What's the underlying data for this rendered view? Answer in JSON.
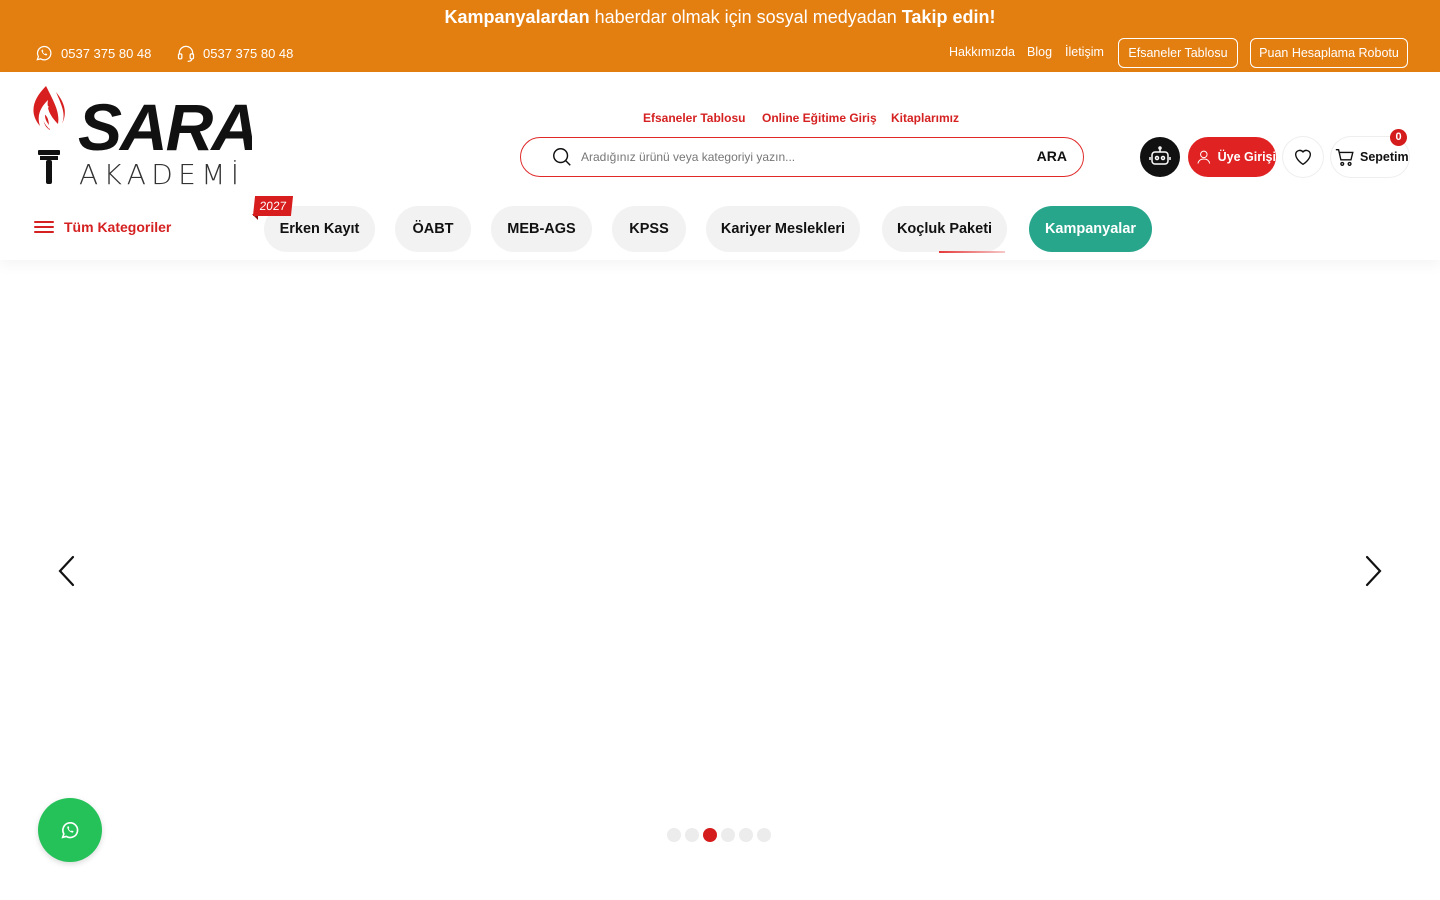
{
  "topbar": {
    "promo_strong1": "Kampanyalardan",
    "promo_mid": " haberdar olmak için sosyal medyadan ",
    "promo_strong2": "Takip edin!",
    "whatsapp_phone": "0537 375 80 48",
    "support_phone": "0537 375 80 48",
    "links": [
      "Hakkımızda",
      "Blog",
      "İletişim"
    ],
    "buttons": [
      "Efsaneler Tablosu",
      "Puan Hesaplama Robotu"
    ],
    "bg_color": "#e37e10"
  },
  "header": {
    "logo_main": "SARA",
    "logo_sub": "AKADEMİ",
    "quick_links": [
      "Efsaneler Tablosu",
      "Online Eğitime Giriş",
      "Kitaplarımız"
    ],
    "search": {
      "placeholder": "Aradığınız ürünü veya kategoriyi yazın...",
      "button_label": "ARA"
    },
    "login_label": "Üye Girişi",
    "cart_label": "Sepetim",
    "cart_count": "0",
    "accent_color": "#e02222"
  },
  "nav": {
    "all_categories": "Tüm Kategoriler",
    "badge": "2027",
    "pills": [
      "Erken Kayıt",
      "ÖABT",
      "MEB-AGS",
      "KPSS",
      "Kariyer Meslekleri",
      "Koçluk Paketi",
      "Kampanyalar"
    ],
    "highlight_color": "#27a68c"
  },
  "slider": {
    "slide_count": 6,
    "active_slide": 3
  },
  "icons": [
    "whatsapp-icon",
    "headset-icon",
    "search-icon",
    "robot-icon",
    "user-icon",
    "heart-icon",
    "cart-icon",
    "menu-icon",
    "chevron-left-icon",
    "chevron-right-icon"
  ]
}
